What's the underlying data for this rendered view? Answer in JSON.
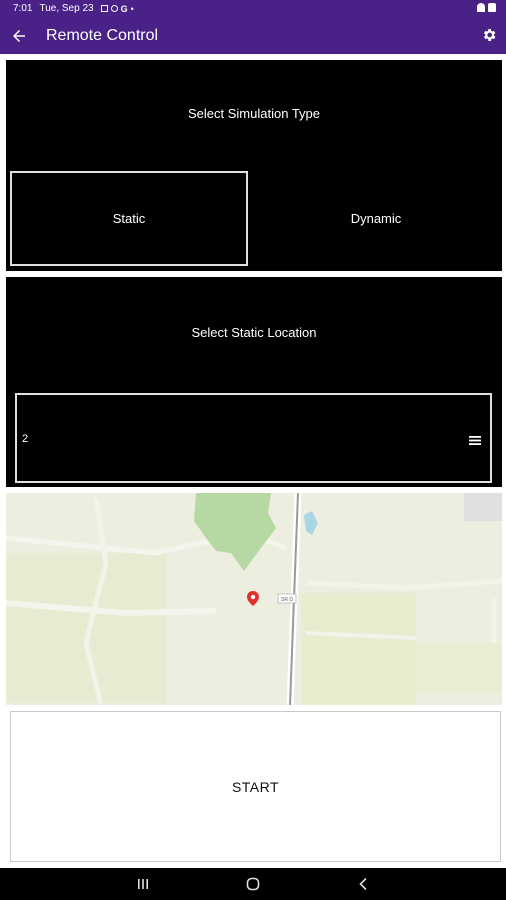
{
  "status_bar": {
    "time": "7:01",
    "date": "Tue, Sep 23"
  },
  "app_bar": {
    "title": "Remote Control",
    "back_icon": "back-arrow-icon",
    "settings_icon": "gear-icon",
    "color": "#4a2187"
  },
  "simulation": {
    "heading": "Select Simulation Type",
    "options": [
      "Static",
      "Dynamic"
    ],
    "selected": "Static"
  },
  "location": {
    "heading": "Select Static Location",
    "selected_value": "2",
    "menu_icon": "menu-icon"
  },
  "map": {
    "road_label": "SR D",
    "marker_icon": "map-pin-icon",
    "marker_color": "#e03131"
  },
  "actions": {
    "start_label": "START"
  },
  "nav": {
    "recents_icon": "recents-icon",
    "home_icon": "home-icon",
    "back_icon": "nav-back-icon"
  }
}
